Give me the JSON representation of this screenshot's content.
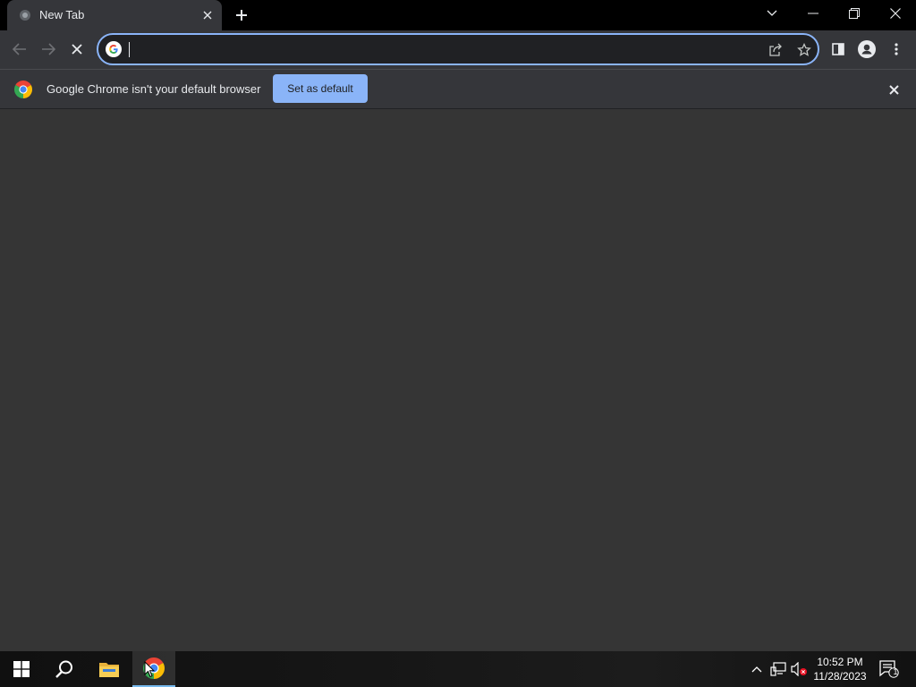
{
  "window": {
    "tab_title": "New Tab",
    "controls": [
      "tab-search",
      "minimize",
      "restore",
      "close"
    ]
  },
  "toolbar": {
    "address_value": "",
    "address_placeholder": ""
  },
  "infobar": {
    "message": "Google Chrome isn't your default browser",
    "button_label": "Set as default"
  },
  "taskbar": {
    "apps": [
      "start",
      "search",
      "file-explorer",
      "chrome"
    ],
    "active_app": "chrome",
    "clock_time": "10:52 PM",
    "clock_date": "11/28/2023",
    "notification_count": "1"
  },
  "colors": {
    "accent": "#8ab4f8",
    "toolbar_bg": "#35363a",
    "content_bg": "#353535",
    "titlebar_bg": "#000000"
  }
}
